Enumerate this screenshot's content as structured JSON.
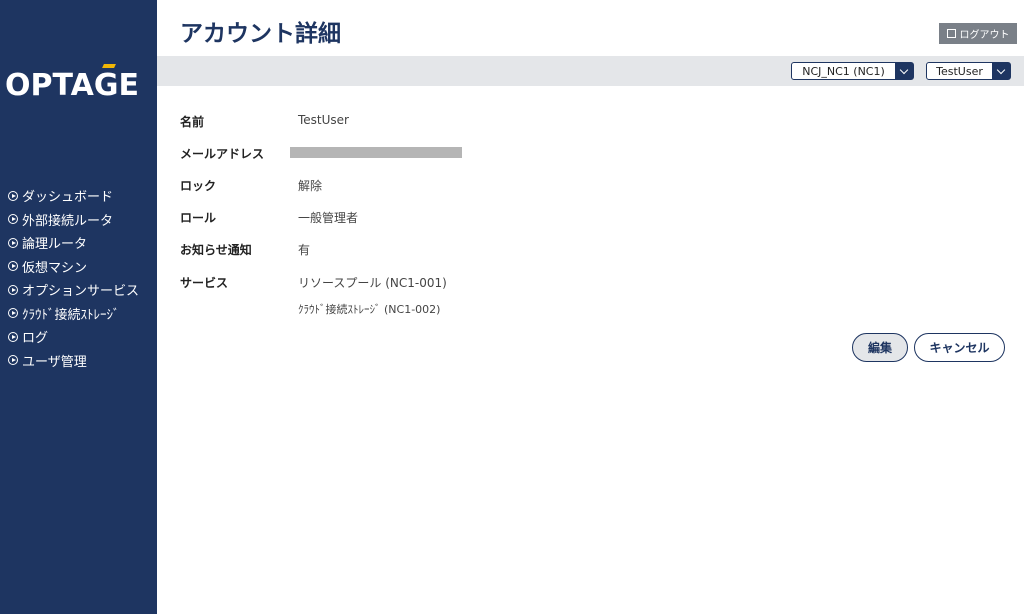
{
  "sidebar": {
    "logo": "OPTAGE",
    "items": [
      {
        "label": "ダッシュボード"
      },
      {
        "label": "外部接続ルータ"
      },
      {
        "label": "論理ルータ"
      },
      {
        "label": "仮想マシン"
      },
      {
        "label": "オプションサービス"
      },
      {
        "label": "ｸﾗｳﾄﾞ接続ｽﾄﾚｰｼﾞ"
      },
      {
        "label": "ログ"
      },
      {
        "label": "ユーザ管理"
      }
    ]
  },
  "header": {
    "title": "アカウント詳細",
    "logout_label": "ログアウト",
    "tenant_select": "NCJ_NC1 (NC1)",
    "user_select": "TestUser"
  },
  "details": {
    "name_label": "名前",
    "name_value": "TestUser",
    "email_label": "メールアドレス",
    "lock_label": "ロック",
    "lock_value": "解除",
    "role_label": "ロール",
    "role_value": "一般管理者",
    "notify_label": "お知らせ通知",
    "notify_value": "有",
    "service_label": "サービス",
    "services": [
      "リソースプール (NC1-001)",
      "ｸﾗｳﾄﾞ接続ｽﾄﾚｰｼﾞ (NC1-002)"
    ]
  },
  "actions": {
    "edit_label": "編集",
    "cancel_label": "キャンセル"
  },
  "colors": {
    "navy": "#1e3561",
    "logo_accent": "#f2b705",
    "logout_bg": "#7a8088",
    "bar_bg": "#e4e6e9"
  }
}
